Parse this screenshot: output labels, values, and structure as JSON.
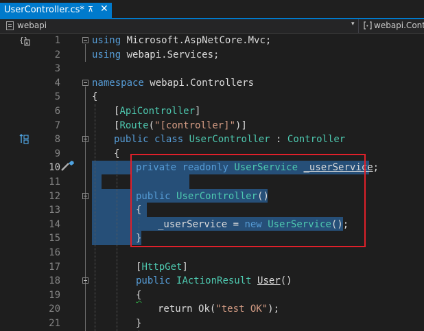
{
  "tab": {
    "title": "UserController.cs*",
    "pin": "⊼",
    "close": "✕"
  },
  "navbar": {
    "project": "webapi",
    "dropdown_arrow": "▾",
    "right_scope": "webapi.Cont"
  },
  "colors": {
    "accent": "#007acc",
    "selection": "#264f78",
    "keyword": "#569cd6",
    "type": "#4ec9b0",
    "string": "#d69d85",
    "highlight_box": "#e0202a"
  },
  "icons": {
    "margin_top": "braces-icon",
    "margin_mid": "implementation-icon",
    "screwdriver": "quick-actions-icon"
  },
  "current_line": 10,
  "line_numbers": [
    "1",
    "2",
    "3",
    "4",
    "5",
    "6",
    "7",
    "8",
    "9",
    "10",
    "11",
    "12",
    "13",
    "14",
    "15",
    "16",
    "17",
    "18",
    "19",
    "20",
    "21"
  ],
  "code": {
    "l1": {
      "kw": "using",
      "rest": " Microsoft.AspNetCore.Mvc;"
    },
    "l2": {
      "kw": "using",
      "rest": " webapi.Services;"
    },
    "l4": {
      "kw": "namespace",
      "rest": " webapi.Controllers"
    },
    "l5": {
      "text": "{"
    },
    "l6": {
      "open": "[",
      "type": "ApiController",
      "close": "]"
    },
    "l7": {
      "open": "[",
      "type": "Route",
      "paren_open": "(",
      "str": "\"[controller]\"",
      "paren_close": ")]"
    },
    "l8": {
      "kw1": "public",
      "kw2": "class",
      "type": "UserController",
      "colon": " : ",
      "base": "Controller"
    },
    "l9": {
      "text": "{"
    },
    "l10": {
      "kw1": "private",
      "kw2": "readonly",
      "type": "UserService",
      "field": "_userService",
      "end": ";"
    },
    "l12": {
      "kw": "public",
      "type": "UserController",
      "parens": "()"
    },
    "l13": {
      "text": "{"
    },
    "l14": {
      "field": "_userService",
      "assign": " = ",
      "kw": "new",
      "type": "UserService",
      "end": "();"
    },
    "l15": {
      "text": "}"
    },
    "l17": {
      "open": "[",
      "type": "HttpGet",
      "close": "]"
    },
    "l18": {
      "kw": "public",
      "type": "IActionResult",
      "method": "User",
      "parens": "()"
    },
    "l19": {
      "text": "{"
    },
    "l20": {
      "kw": "return",
      "method": "Ok",
      "paren_open": "(",
      "str": "\"test OK\"",
      "end": ");"
    },
    "l21": {
      "text": "}"
    }
  }
}
